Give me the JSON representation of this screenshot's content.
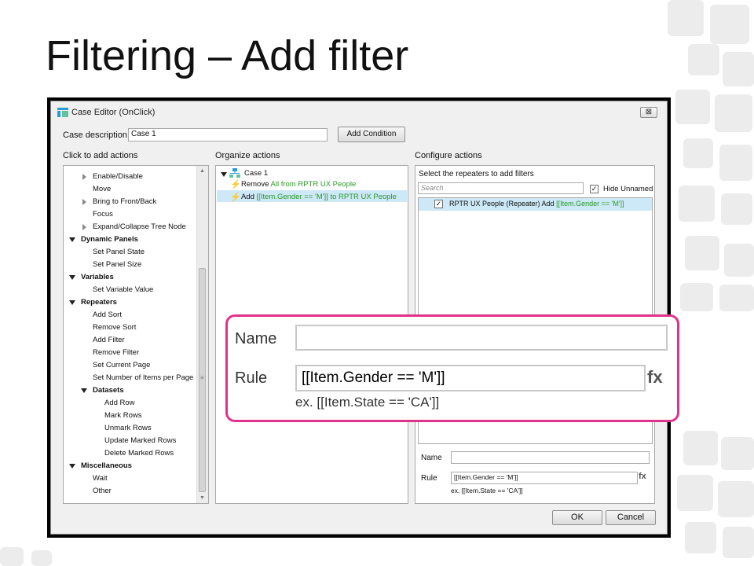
{
  "slide": {
    "title": "Filtering – Add filter"
  },
  "dialog": {
    "title": "Case Editor (OnClick)",
    "close_glyph": "⊠",
    "case_description_label": "Case description",
    "case_description_value": "Case 1",
    "add_condition_label": "Add Condition",
    "click_to_add_actions_label": "Click to add actions",
    "organize_actions_label": "Organize actions",
    "configure_actions_label": "Configure actions",
    "ok_label": "OK",
    "cancel_label": "Cancel"
  },
  "actions_tree": [
    {
      "label": "Enable/Disable",
      "level": 1,
      "bold": false,
      "expand": "collapsed"
    },
    {
      "label": "Move",
      "level": 1,
      "bold": false,
      "expand": "none"
    },
    {
      "label": "Bring to Front/Back",
      "level": 1,
      "bold": false,
      "expand": "collapsed"
    },
    {
      "label": "Focus",
      "level": 1,
      "bold": false,
      "expand": "none"
    },
    {
      "label": "Expand/Collapse Tree Node",
      "level": 1,
      "bold": false,
      "expand": "collapsed"
    },
    {
      "label": "Dynamic Panels",
      "level": 0,
      "bold": true,
      "expand": "expanded"
    },
    {
      "label": "Set Panel State",
      "level": 1,
      "bold": false,
      "expand": "none"
    },
    {
      "label": "Set Panel Size",
      "level": 1,
      "bold": false,
      "expand": "none"
    },
    {
      "label": "Variables",
      "level": 0,
      "bold": true,
      "expand": "expanded"
    },
    {
      "label": "Set Variable Value",
      "level": 1,
      "bold": false,
      "expand": "none"
    },
    {
      "label": "Repeaters",
      "level": 0,
      "bold": true,
      "expand": "expanded"
    },
    {
      "label": "Add Sort",
      "level": 1,
      "bold": false,
      "expand": "none"
    },
    {
      "label": "Remove Sort",
      "level": 1,
      "bold": false,
      "expand": "none"
    },
    {
      "label": "Add Filter",
      "level": 1,
      "bold": false,
      "expand": "none"
    },
    {
      "label": "Remove Filter",
      "level": 1,
      "bold": false,
      "expand": "none"
    },
    {
      "label": "Set Current Page",
      "level": 1,
      "bold": false,
      "expand": "none"
    },
    {
      "label": "Set Number of Items per Page",
      "level": 1,
      "bold": false,
      "expand": "none"
    },
    {
      "label": "Datasets",
      "level": 1,
      "bold": true,
      "expand": "expanded"
    },
    {
      "label": "Add Row",
      "level": 2,
      "bold": false,
      "expand": "none"
    },
    {
      "label": "Mark Rows",
      "level": 2,
      "bold": false,
      "expand": "none"
    },
    {
      "label": "Unmark Rows",
      "level": 2,
      "bold": false,
      "expand": "none"
    },
    {
      "label": "Update Marked Rows",
      "level": 2,
      "bold": false,
      "expand": "none"
    },
    {
      "label": "Delete Marked Rows",
      "level": 2,
      "bold": false,
      "expand": "none"
    },
    {
      "label": "Miscellaneous",
      "level": 0,
      "bold": true,
      "expand": "expanded"
    },
    {
      "label": "Wait",
      "level": 1,
      "bold": false,
      "expand": "none"
    },
    {
      "label": "Other",
      "level": 1,
      "bold": false,
      "expand": "none"
    }
  ],
  "organize": {
    "case_label": "Case 1",
    "action1_verb": "Remove ",
    "action1_detail": "All from RPTR UX People",
    "action2_verb": "Add ",
    "action2_expr": "[[Item.Gender == 'M']]",
    "action2_rest": " to RPTR UX People"
  },
  "configure": {
    "select_repeaters_label": "Select the repeaters to add filters",
    "search_placeholder": "Search",
    "hide_unnamed_label": "Hide Unnamed",
    "repeater_row_text": "RPTR UX People (Repeater) Add ",
    "repeater_row_expr": "[[Item.Gender == 'M']]",
    "name_label": "Name",
    "name_value": "",
    "rule_label": "Rule",
    "rule_value": "[[Item.Gender == 'M']]",
    "fx_label": "fx",
    "example_text": "ex. [[Item.State == 'CA']]"
  },
  "zoom": {
    "name_label": "Name",
    "name_value": "",
    "rule_label": "Rule",
    "rule_value": "[[Item.Gender == 'M']]",
    "fx_label": "fx",
    "example_text": "ex. [[Item.State == 'CA']]",
    "border_color": "#e0328a"
  },
  "colors": {
    "accent_green": "#2a9a2a",
    "selection": "#cde8f6",
    "tree_icon": "#2b9bd8"
  }
}
